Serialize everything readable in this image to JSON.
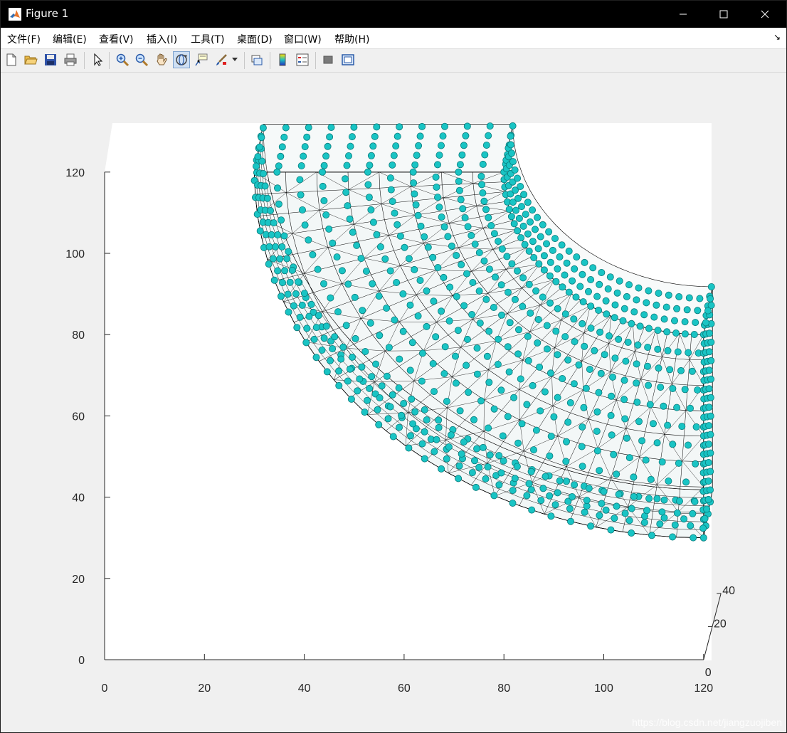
{
  "window": {
    "title": "Figure 1"
  },
  "menu": [
    "文件(F)",
    "编辑(E)",
    "查看(V)",
    "插入(I)",
    "工具(T)",
    "桌面(D)",
    "窗口(W)",
    "帮助(H)"
  ],
  "toolbar": {
    "buttons": [
      {
        "name": "new-figure-icon"
      },
      {
        "name": "open-file-icon"
      },
      {
        "name": "save-icon"
      },
      {
        "name": "print-icon"
      },
      {
        "name": "edit-plot-arrow-icon"
      },
      {
        "name": "zoom-in-icon"
      },
      {
        "name": "zoom-out-icon"
      },
      {
        "name": "pan-hand-icon"
      },
      {
        "name": "rotate-3d-icon",
        "active": true
      },
      {
        "name": "data-cursor-icon"
      },
      {
        "name": "brush-icon"
      },
      {
        "name": "link-plot-icon"
      },
      {
        "name": "insert-colorbar-icon"
      },
      {
        "name": "insert-legend-icon"
      },
      {
        "name": "hide-plot-tools-icon"
      },
      {
        "name": "show-plot-tools-icon"
      }
    ]
  },
  "colors": {
    "node": "#19c4c4",
    "node_dark": "#0a7a7a",
    "mesh": "#000000",
    "face_fill": "#f2f6f6",
    "axes_bg": "#ffffff"
  },
  "chart_data": {
    "type": "scatter",
    "title": "",
    "xlabel": "",
    "ylabel": "",
    "zlabel": "",
    "grid": false,
    "xlim": [
      0,
      120
    ],
    "ylim": [
      0,
      120
    ],
    "zlim": [
      0,
      40
    ],
    "xticks": [
      "0",
      "20",
      "40",
      "60",
      "80",
      "100",
      "120"
    ],
    "yticks": [
      "0",
      "20",
      "40",
      "60",
      "80",
      "100",
      "120"
    ],
    "zticks": [
      "0",
      "20",
      "40"
    ],
    "shape": {
      "description": "quarter-annulus bent-pipe mesh with node markers",
      "center": [
        120,
        120
      ],
      "inner_radius": 40,
      "outer_radius": 90,
      "thickness": 40
    }
  },
  "watermark": "https://blog.csdn.net/jiangzuojiben"
}
